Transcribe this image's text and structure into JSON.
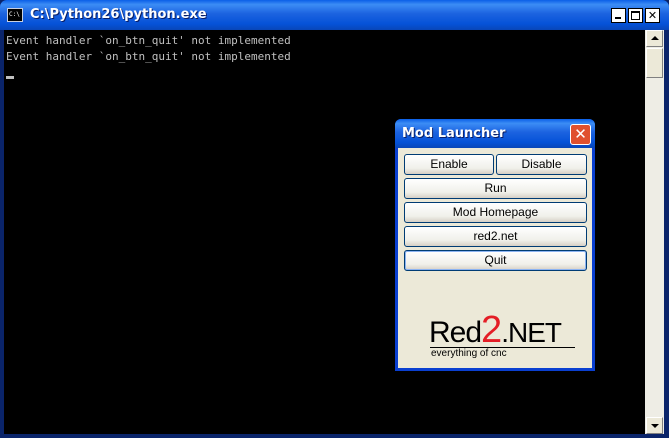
{
  "console": {
    "title": "C:\\Python26\\python.exe",
    "icon": "console-app-icon",
    "lines": [
      "Event handler `on_btn_quit' not implemented",
      "Event handler `on_btn_quit' not implemented"
    ]
  },
  "launcher": {
    "title": "Mod Launcher",
    "buttons": {
      "enable": "Enable",
      "disable": "Disable",
      "run": "Run",
      "homepage": "Mod Homepage",
      "site": "red2.net",
      "quit": "Quit"
    },
    "logo": {
      "part1": "Red",
      "part2": "2",
      "part3": ".NET",
      "tagline": "everything of cnc"
    }
  },
  "colors": {
    "titlebar": "#0A5FE8",
    "logo_accent": "#E41E26",
    "console_bg": "#000000",
    "console_text": "#C0C0C0"
  }
}
